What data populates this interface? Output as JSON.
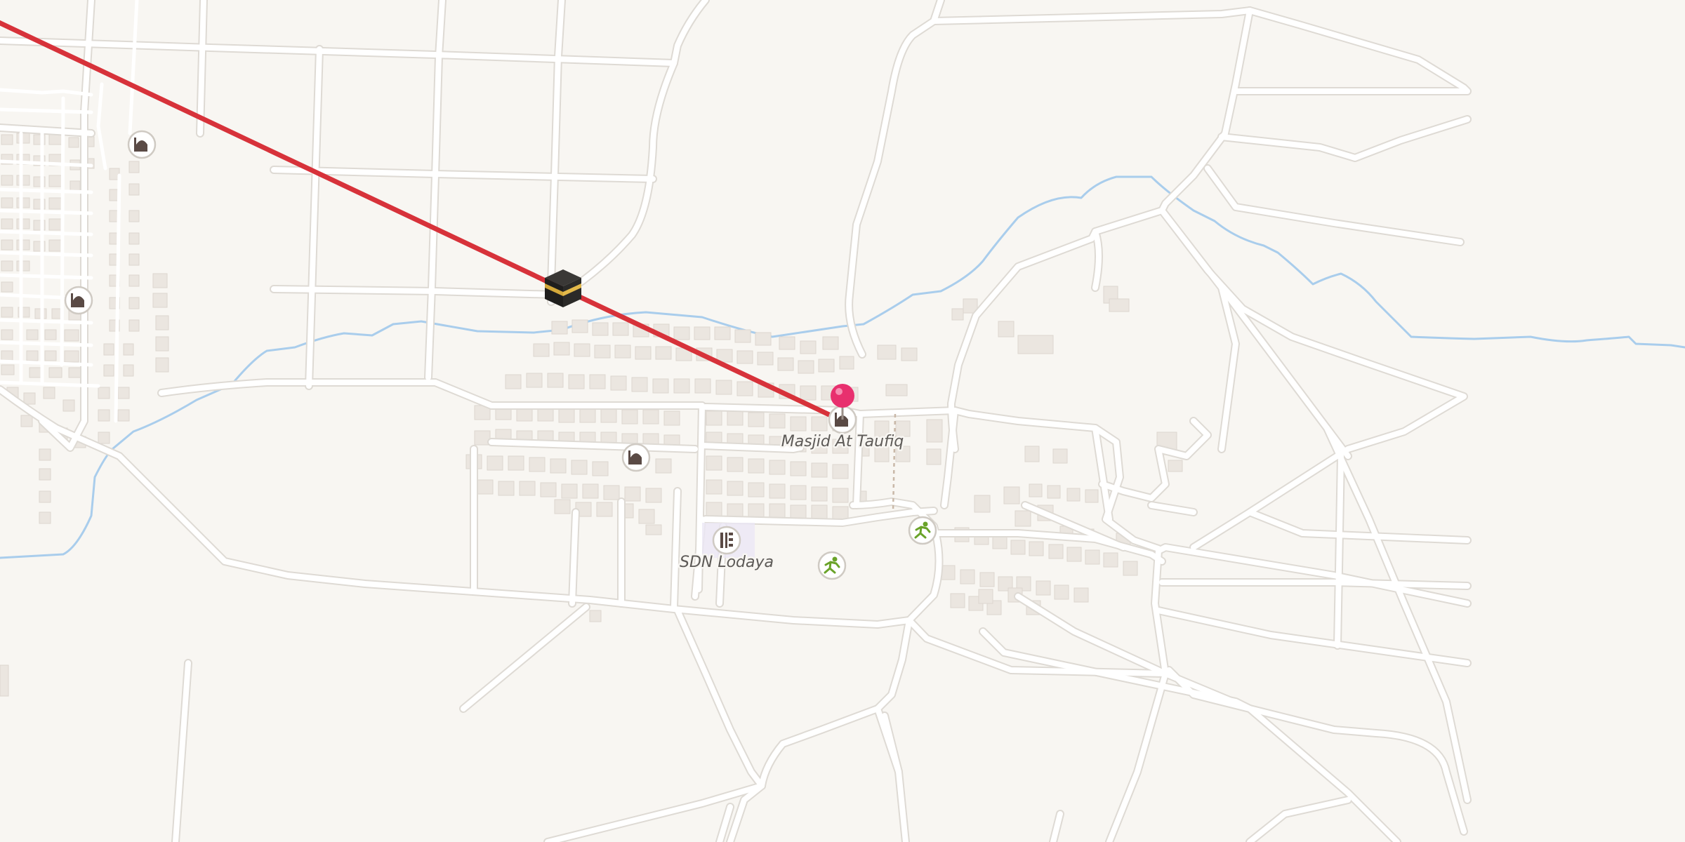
{
  "map": {
    "labels": {
      "masjid": "Masjid At Taufiq",
      "school": "SDN Lodaya"
    },
    "icons": {
      "kaaba": "kaaba-icon",
      "mosque": "mosque-icon",
      "school": "school-icon",
      "sports": "running-icon",
      "pin": "location-pin-icon"
    },
    "colors": {
      "background": "#f8f6f2",
      "road": "#ffffff",
      "road_casing": "#dedad4",
      "building": "#ebe6e0",
      "water": "#a9cdec",
      "qibla_line": "#d7323a",
      "pin": "#e8306e",
      "sports_icon": "#6aa329",
      "mosque_icon": "#5a4a45"
    }
  }
}
